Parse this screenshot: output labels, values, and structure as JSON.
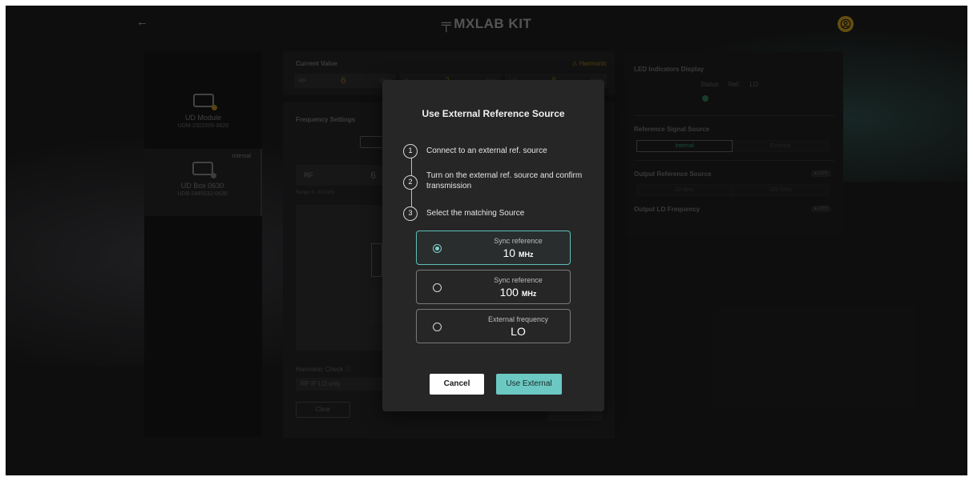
{
  "app": {
    "title": "MXLAB KIT",
    "logo_glyph": "╤",
    "back_glyph": "←"
  },
  "devices": [
    {
      "name": "UD Module",
      "id": "UDM-2322005-0620",
      "tag": ""
    },
    {
      "name": "UD Box 0630",
      "id": "UDB-2445032-0630",
      "tag": "Internal"
    }
  ],
  "current_value": {
    "title": "Current Value",
    "harmonic": "⚠ Harmonic",
    "cells": [
      {
        "label": "RF",
        "value": "6",
        "unit": "GHz"
      },
      {
        "label": "IF",
        "value": "2",
        "unit": "GHz"
      },
      {
        "label": "LO",
        "value": "8",
        "unit": "GHz"
      }
    ]
  },
  "frequency_settings": {
    "title": "Frequency Settings",
    "rf_label": "RF",
    "rf_value": "6",
    "range": "Range 6 - 10 GHz",
    "harmonic_label": "Harmonic Check ⓘ",
    "harmonic_select": "RF IF LO only",
    "clear_label": "Clear"
  },
  "right_panel": {
    "led_title": "LED Indicators Display",
    "led_labels": [
      "Status",
      "Ref.",
      "LO"
    ],
    "ref_title": "Reference Signal Source",
    "ref_options": [
      "Internal",
      "External"
    ],
    "out_ref_title": "Output Reference Source",
    "out_ref_toggle": "● OFF",
    "out_ref_options": [
      "10 MHz",
      "100 MHz"
    ],
    "out_lo_title": "Output LO Frequency",
    "out_lo_toggle": "● OFF"
  },
  "modal": {
    "title": "Use External Reference Source",
    "steps": [
      {
        "num": "1",
        "text": "Connect to an external ref. source"
      },
      {
        "num": "2",
        "text": "Turn on the external ref. source and confirm transmission"
      },
      {
        "num": "3",
        "text": "Select the matching Source"
      }
    ],
    "options": [
      {
        "label": "Sync reference",
        "value": "10",
        "unit": "MHz",
        "selected": true
      },
      {
        "label": "Sync reference",
        "value": "100",
        "unit": "MHz",
        "selected": false
      },
      {
        "label": "External frequency",
        "value": "LO",
        "unit": "",
        "selected": false
      }
    ],
    "cancel_label": "Cancel",
    "confirm_label": "Use External"
  },
  "colors": {
    "accent": "#6cc8c2",
    "warning": "#b98e1d",
    "background": "#1b1b1b",
    "modal": "#262626"
  }
}
